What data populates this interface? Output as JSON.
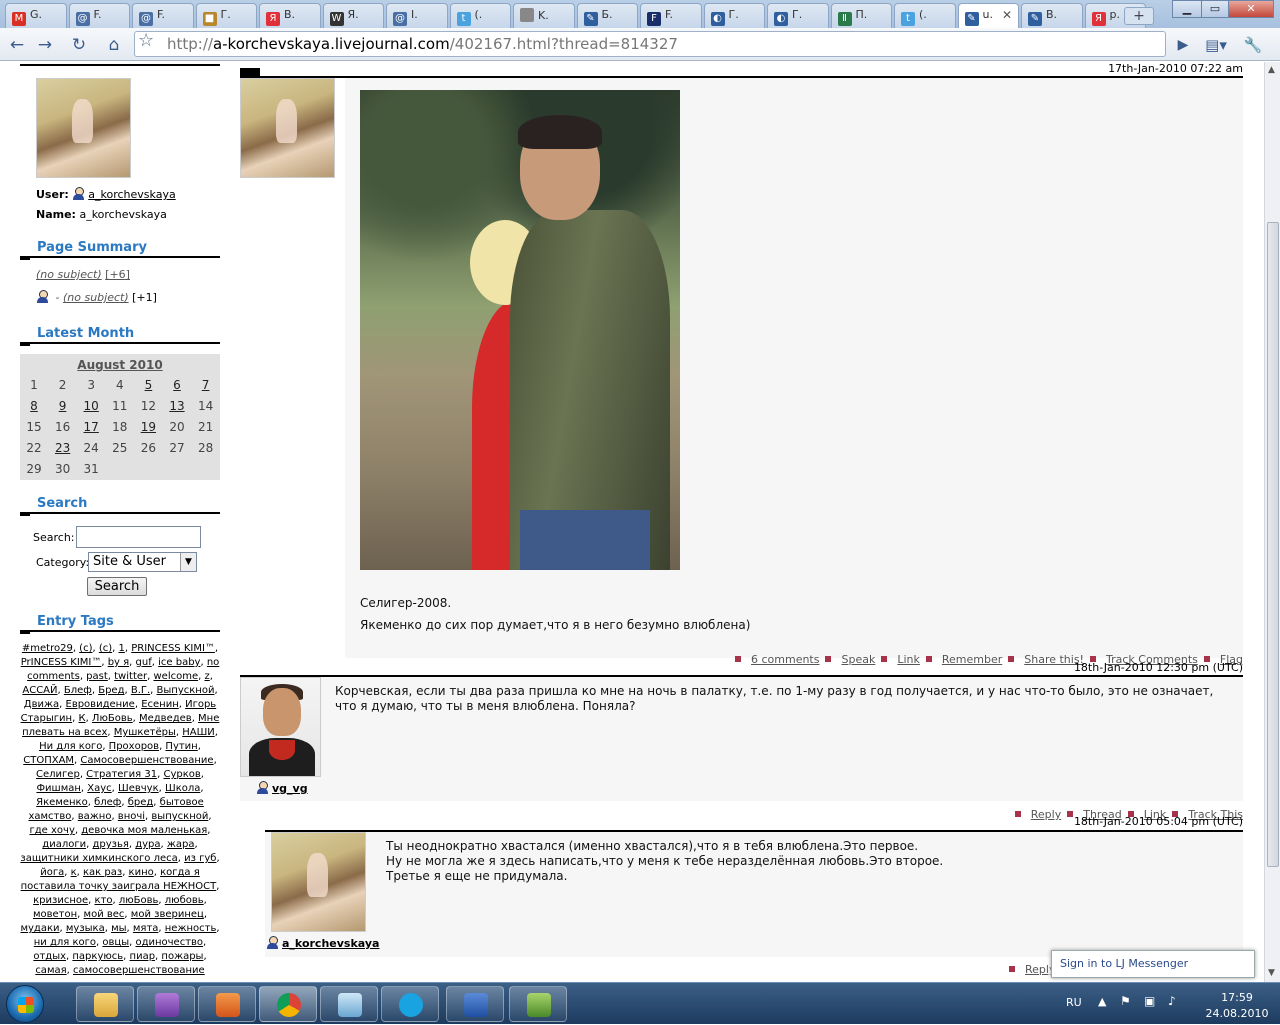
{
  "tabs": [
    {
      "label": "G.",
      "icon": "gmail-icon",
      "color": "#d93025",
      "glyph": "M"
    },
    {
      "label": "F.",
      "icon": "feed-icon",
      "color": "#4a6fa5",
      "glyph": "@"
    },
    {
      "label": "F.",
      "icon": "feed-icon",
      "color": "#4a6fa5",
      "glyph": "@"
    },
    {
      "label": "Г.",
      "icon": "box-icon",
      "color": "#b8862b",
      "glyph": "■"
    },
    {
      "label": "В.",
      "icon": "yandex-icon",
      "color": "#e0303a",
      "glyph": "Я"
    },
    {
      "label": "Я.",
      "icon": "wikipedia-icon",
      "color": "#333",
      "glyph": "W"
    },
    {
      "label": "I.",
      "icon": "feed-icon",
      "color": "#4a6fa5",
      "glyph": "@"
    },
    {
      "label": "(.",
      "icon": "twitter-icon",
      "color": "#4aa3df",
      "glyph": "t"
    },
    {
      "label": "K.",
      "icon": "page-icon",
      "color": "#888",
      "glyph": ""
    },
    {
      "label": "Б.",
      "icon": "livejournal-icon",
      "color": "#2f5f9e",
      "glyph": "✎"
    },
    {
      "label": "F.",
      "icon": "forbes-icon",
      "color": "#1a2f6a",
      "glyph": "F"
    },
    {
      "label": "Г.",
      "icon": "globe-icon",
      "color": "#2f5f9e",
      "glyph": "◐"
    },
    {
      "label": "Г.",
      "icon": "globe-icon",
      "color": "#2f5f9e",
      "glyph": "◐"
    },
    {
      "label": "П.",
      "icon": "olit-icon",
      "color": "#2a7a4a",
      "glyph": "Ⅱ"
    },
    {
      "label": "(.",
      "icon": "twitter-icon",
      "color": "#4aa3df",
      "glyph": "t"
    },
    {
      "label": "u.",
      "icon": "livejournal-icon",
      "color": "#2f5f9e",
      "glyph": "✎",
      "active": true
    },
    {
      "label": "В.",
      "icon": "livejournal-icon",
      "color": "#2f5f9e",
      "glyph": "✎"
    },
    {
      "label": "р.",
      "icon": "yandex-icon",
      "color": "#e0303a",
      "glyph": "Я"
    }
  ],
  "url": {
    "prefix": "http://",
    "host": "a-korchevskaya.livejournal.com",
    "path": "/402167.html?thread=814327"
  },
  "profile": {
    "user_label": "User:",
    "user": "a_korchevskaya",
    "name_label": "Name:",
    "name": "a_korchevskaya"
  },
  "page_summary": {
    "title": "Page Summary",
    "item1": "(no subject)",
    "item1_count": "[+6]",
    "item2_sep": " - ",
    "item2": "(no subject)",
    "item2_count": "[+1]"
  },
  "latest_month": {
    "title": "Latest Month",
    "month": "August 2010",
    "weeks": [
      [
        {
          "d": "1",
          "l": false
        },
        {
          "d": "2",
          "l": false
        },
        {
          "d": "3",
          "l": false
        },
        {
          "d": "4",
          "l": false
        },
        {
          "d": "5",
          "l": true
        },
        {
          "d": "6",
          "l": true
        },
        {
          "d": "7",
          "l": true
        }
      ],
      [
        {
          "d": "8",
          "l": true
        },
        {
          "d": "9",
          "l": true
        },
        {
          "d": "10",
          "l": true
        },
        {
          "d": "11",
          "l": false
        },
        {
          "d": "12",
          "l": false
        },
        {
          "d": "13",
          "l": true
        },
        {
          "d": "14",
          "l": false
        }
      ],
      [
        {
          "d": "15",
          "l": false
        },
        {
          "d": "16",
          "l": false
        },
        {
          "d": "17",
          "l": true
        },
        {
          "d": "18",
          "l": false
        },
        {
          "d": "19",
          "l": true
        },
        {
          "d": "20",
          "l": false
        },
        {
          "d": "21",
          "l": false
        }
      ],
      [
        {
          "d": "22",
          "l": false
        },
        {
          "d": "23",
          "l": true
        },
        {
          "d": "24",
          "l": false
        },
        {
          "d": "25",
          "l": false
        },
        {
          "d": "26",
          "l": false
        },
        {
          "d": "27",
          "l": false
        },
        {
          "d": "28",
          "l": false
        }
      ],
      [
        {
          "d": "29",
          "l": false
        },
        {
          "d": "30",
          "l": false
        },
        {
          "d": "31",
          "l": false
        }
      ]
    ]
  },
  "search": {
    "title": "Search",
    "search_label": "Search:",
    "category_label": "Category:",
    "category_value": "Site & User",
    "button": "Search"
  },
  "entry_tags": {
    "title": "Entry Tags",
    "tags": [
      "#metro29",
      "(c)",
      "(с)",
      "1",
      "PRINCESS KIMI™",
      "PrINCESS KIMI™",
      "by я",
      "guf",
      "ice baby",
      "no comments",
      "past",
      "twitter",
      "welcome",
      "z",
      "АССАЙ",
      "Блеф",
      "Бред",
      "В.Г.",
      "Выпускной",
      "Движа",
      "Евровидение",
      "Есенин",
      "Игорь Старыгин",
      "К",
      "ЛюБовь",
      "Медведев",
      "Мне плевать на всех",
      "Мушкетёры",
      "НАШИ",
      "Ни для кого",
      "Прохоров",
      "Путин",
      "СТОПХАМ",
      "Самосовершенствование",
      "Селигер",
      "Стратегия 31",
      "Сурков",
      "Фишман",
      "Хаус",
      "Шевчук",
      "Школа",
      "Якеменко",
      "блеф",
      "бред",
      "бытовое хамство",
      "важно",
      "вночі",
      "выпускной",
      "где хочу",
      "девочка моя маленькая",
      "диалоги",
      "друзья",
      "дура",
      "жара",
      "защитники химкинского леса",
      "из губ",
      "йога",
      "к",
      "как раз",
      "кино",
      "когда я поставила точку заиграла НЕЖНОСТ",
      "кризисное",
      "кто",
      "люБовь",
      "любовь",
      "моветон",
      "мой вес",
      "мой зверинец",
      "мудаки",
      "музыка",
      "мы",
      "мята",
      "нежность",
      "ни для кого",
      "овцы",
      "одиночество",
      "отдых",
      "паркуюсь",
      "пиар",
      "пожары",
      "самая",
      "самосовершенствование"
    ]
  },
  "entry": {
    "timestamp": "17th-Jan-2010 07:22 am",
    "caption1": "Селигер-2008.",
    "caption2": "Якеменко до сих пор думает,что я в него безумно влюблена)",
    "actions": [
      "6 comments",
      "Speak",
      "Link",
      "Remember",
      "Share this!",
      "Track Comments",
      "Flag"
    ]
  },
  "comment1": {
    "timestamp": "18th-Jan-2010 12:30 pm (UTC)",
    "user": "vg_vg",
    "text": "Корчевская, если ты два раза пришла ко мне на ночь в палатку, т.е. по 1-му разу в год получается, и у нас что-то было, это не означает, что я думаю, что ты в меня влюблена. Поняла?",
    "actions": [
      "Reply",
      "Thread",
      "Link",
      "Track This"
    ]
  },
  "comment2": {
    "timestamp": "18th-Jan-2010 05:04 pm (UTC)",
    "user": "a_korchevskaya",
    "line1": "Ты неоднократно хвастался (именно хвастался),что я в тебя влюблена.Это первое.",
    "line2": "Ну не могла же я здесь написать,что у меня к тебе неразделённая любовь.Это второе.",
    "line3": "Третье я еще не придумала.",
    "reply": "Reply"
  },
  "messenger": {
    "label": "Sign in to LJ Messenger"
  },
  "tray": {
    "lang": "RU",
    "time": "17:59",
    "date": "24.08.2010"
  }
}
